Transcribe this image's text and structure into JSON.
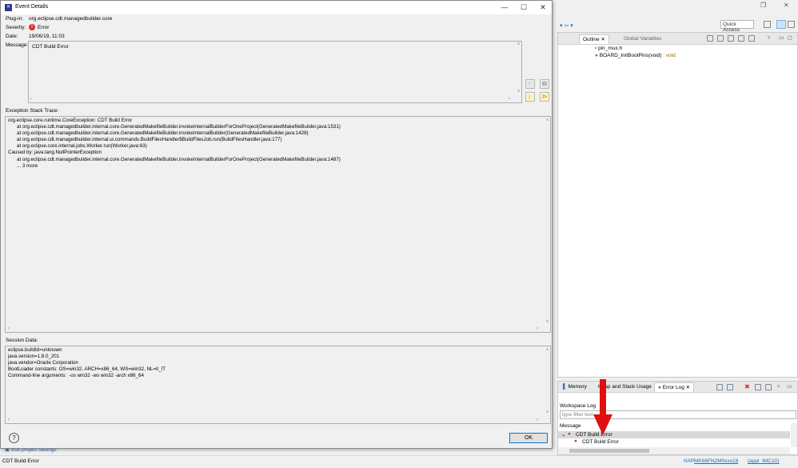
{
  "dialog": {
    "title": "Event Details",
    "plugin_label": "Plug-in:",
    "plugin_value": "org.eclipse.cdt.managedbuilder.core",
    "severity_label": "Severity:",
    "severity_value": "Error",
    "date_label": "Date:",
    "date_value": "19/06/19, 11:03",
    "message_label": "Message:",
    "message_value": "CDT Build Error",
    "stack_label": "Exception Stack Trace:",
    "stack_lines": [
      "org.eclipse.core.runtime.CoreException: CDT Build Error",
      "\tat org.eclipse.cdt.managedbuilder.internal.core.GeneratedMakefileBuilder.invokeInternalBuilderForOneProject(GeneratedMakefileBuilder.java:1531)",
      "\tat org.eclipse.cdt.managedbuilder.internal.core.GeneratedMakefileBuilder.invokeInternalBuilder(GeneratedMakefileBuilder.java:1428)",
      "\tat org.eclipse.cdt.managedbuilder.internal.ui.commands.BuildFilesHandler$BuildFilesJob.run(BuildFilesHandler.java:177)",
      "\tat org.eclipse.core.internal.jobs.Worker.run(Worker.java:63)",
      "Caused by: java.lang.NullPointerException",
      "\tat org.eclipse.cdt.managedbuilder.internal.core.GeneratedMakefileBuilder.invokeInternalBuilderForOneProject(GeneratedMakefileBuilder.java:1487)",
      "\t... 3 more"
    ],
    "session_label": "Session Data:",
    "session_lines": [
      "eclipse.buildId=unknown",
      "java.version=1.8.0_201",
      "java.vendor=Oracle Corporation",
      "BootLoader constants: OS=win32, ARCH=x86_64, WS=win32, NL=it_IT",
      "Command-line arguments:  -os win32 -ws win32 -arch x86_64"
    ],
    "ok_label": "OK",
    "help_label": "?"
  },
  "ide": {
    "quick_access": "Quick Access",
    "outline_tab": "Outline",
    "global_vars_tab": "Global Variables",
    "outline_items": [
      {
        "label": "pin_mux.h",
        "suffix": ""
      },
      {
        "label": "BOARD_InitBootPins(void)",
        "suffix": " : void"
      }
    ],
    "memory_tab": "Memory",
    "heap_tab": "Heap and Stack Usage",
    "errorlog_tab": "Error Log",
    "workspace_log": "Workspace Log",
    "filter_placeholder": "type filter text",
    "message_header": "Message",
    "log_rows": [
      "CDT Build Error",
      "CDT Build Error"
    ],
    "bottom_link": "Edit project settings",
    "status_left": "CDT Build Error",
    "status_nxp": "NXP",
    "status_device": "MK66FN2M0xxx18",
    "status_project": "(appl_IMC10)"
  },
  "colors": {
    "accent": "#0078d7",
    "error": "#d93030",
    "arrow": "#e01010"
  }
}
